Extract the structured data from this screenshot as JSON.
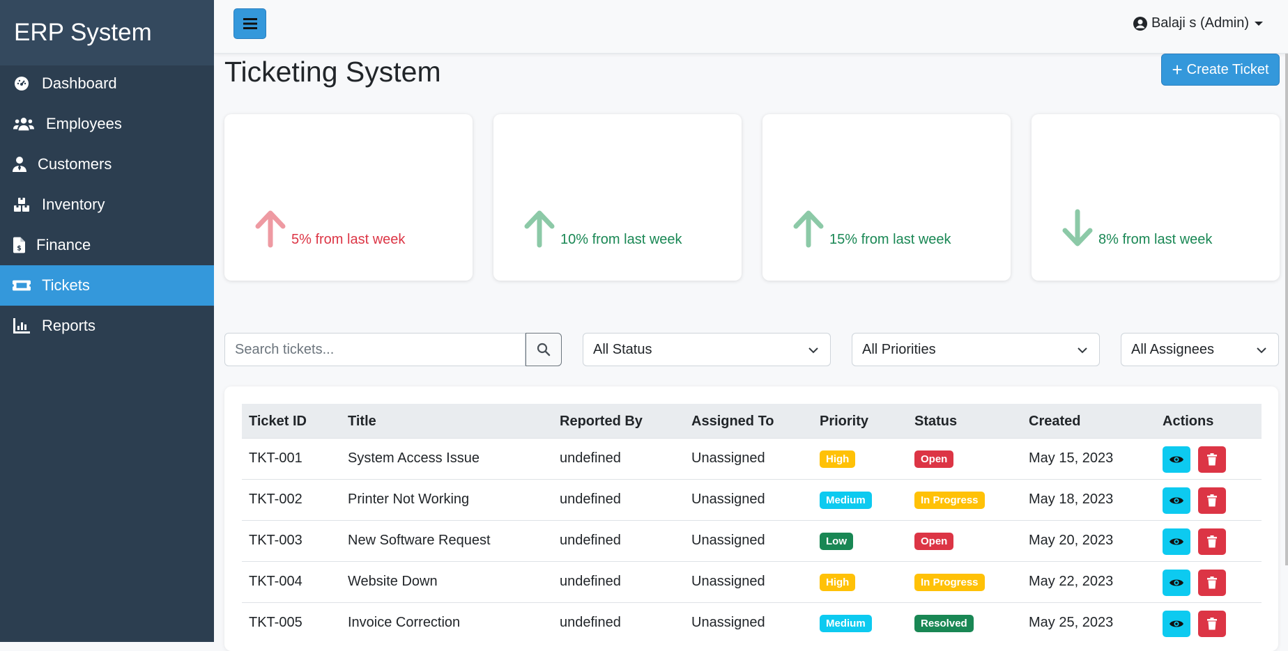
{
  "sidebar": {
    "brand": "ERP System",
    "items": [
      {
        "label": "Dashboard",
        "icon": "dashboard-icon"
      },
      {
        "label": "Employees",
        "icon": "users-icon"
      },
      {
        "label": "Customers",
        "icon": "user-tie-icon"
      },
      {
        "label": "Inventory",
        "icon": "boxes-icon"
      },
      {
        "label": "Finance",
        "icon": "invoice-icon"
      },
      {
        "label": "Tickets",
        "icon": "ticket-icon",
        "active": true
      },
      {
        "label": "Reports",
        "icon": "chart-icon"
      }
    ]
  },
  "topbar": {
    "user": "Balaji s (Admin)"
  },
  "page": {
    "title": "Ticketing System",
    "create_label": "Create Ticket"
  },
  "stats": [
    {
      "text": "5% from last week",
      "direction": "up",
      "color": "#dc3545"
    },
    {
      "text": "10% from last week",
      "direction": "up",
      "color": "#198754"
    },
    {
      "text": "15% from last week",
      "direction": "up",
      "color": "#198754"
    },
    {
      "text": "8% from last week",
      "direction": "down",
      "color": "#198754"
    }
  ],
  "filters": {
    "search_placeholder": "Search tickets...",
    "status": "All Status",
    "priority": "All Priorities",
    "assignee": "All Assignees"
  },
  "table": {
    "headers": [
      "Ticket ID",
      "Title",
      "Reported By",
      "Assigned To",
      "Priority",
      "Status",
      "Created",
      "Actions"
    ],
    "rows": [
      {
        "id": "TKT-001",
        "title": "System Access Issue",
        "reported_by": "undefined",
        "assigned_to": "Unassigned",
        "priority": "High",
        "status": "Open",
        "created": "May 15, 2023"
      },
      {
        "id": "TKT-002",
        "title": "Printer Not Working",
        "reported_by": "undefined",
        "assigned_to": "Unassigned",
        "priority": "Medium",
        "status": "In Progress",
        "created": "May 18, 2023"
      },
      {
        "id": "TKT-003",
        "title": "New Software Request",
        "reported_by": "undefined",
        "assigned_to": "Unassigned",
        "priority": "Low",
        "status": "Open",
        "created": "May 20, 2023"
      },
      {
        "id": "TKT-004",
        "title": "Website Down",
        "reported_by": "undefined",
        "assigned_to": "Unassigned",
        "priority": "High",
        "status": "In Progress",
        "created": "May 22, 2023"
      },
      {
        "id": "TKT-005",
        "title": "Invoice Correction",
        "reported_by": "undefined",
        "assigned_to": "Unassigned",
        "priority": "Medium",
        "status": "Resolved",
        "created": "May 25, 2023"
      }
    ]
  },
  "colors": {
    "sidebar_bg": "#2c3e50",
    "accent": "#3498db",
    "priority_high": "#ffc107",
    "priority_medium": "#0dcaf0",
    "priority_low": "#198754",
    "status_open": "#dc3545",
    "status_in_progress": "#ffc107",
    "status_resolved": "#198754"
  }
}
